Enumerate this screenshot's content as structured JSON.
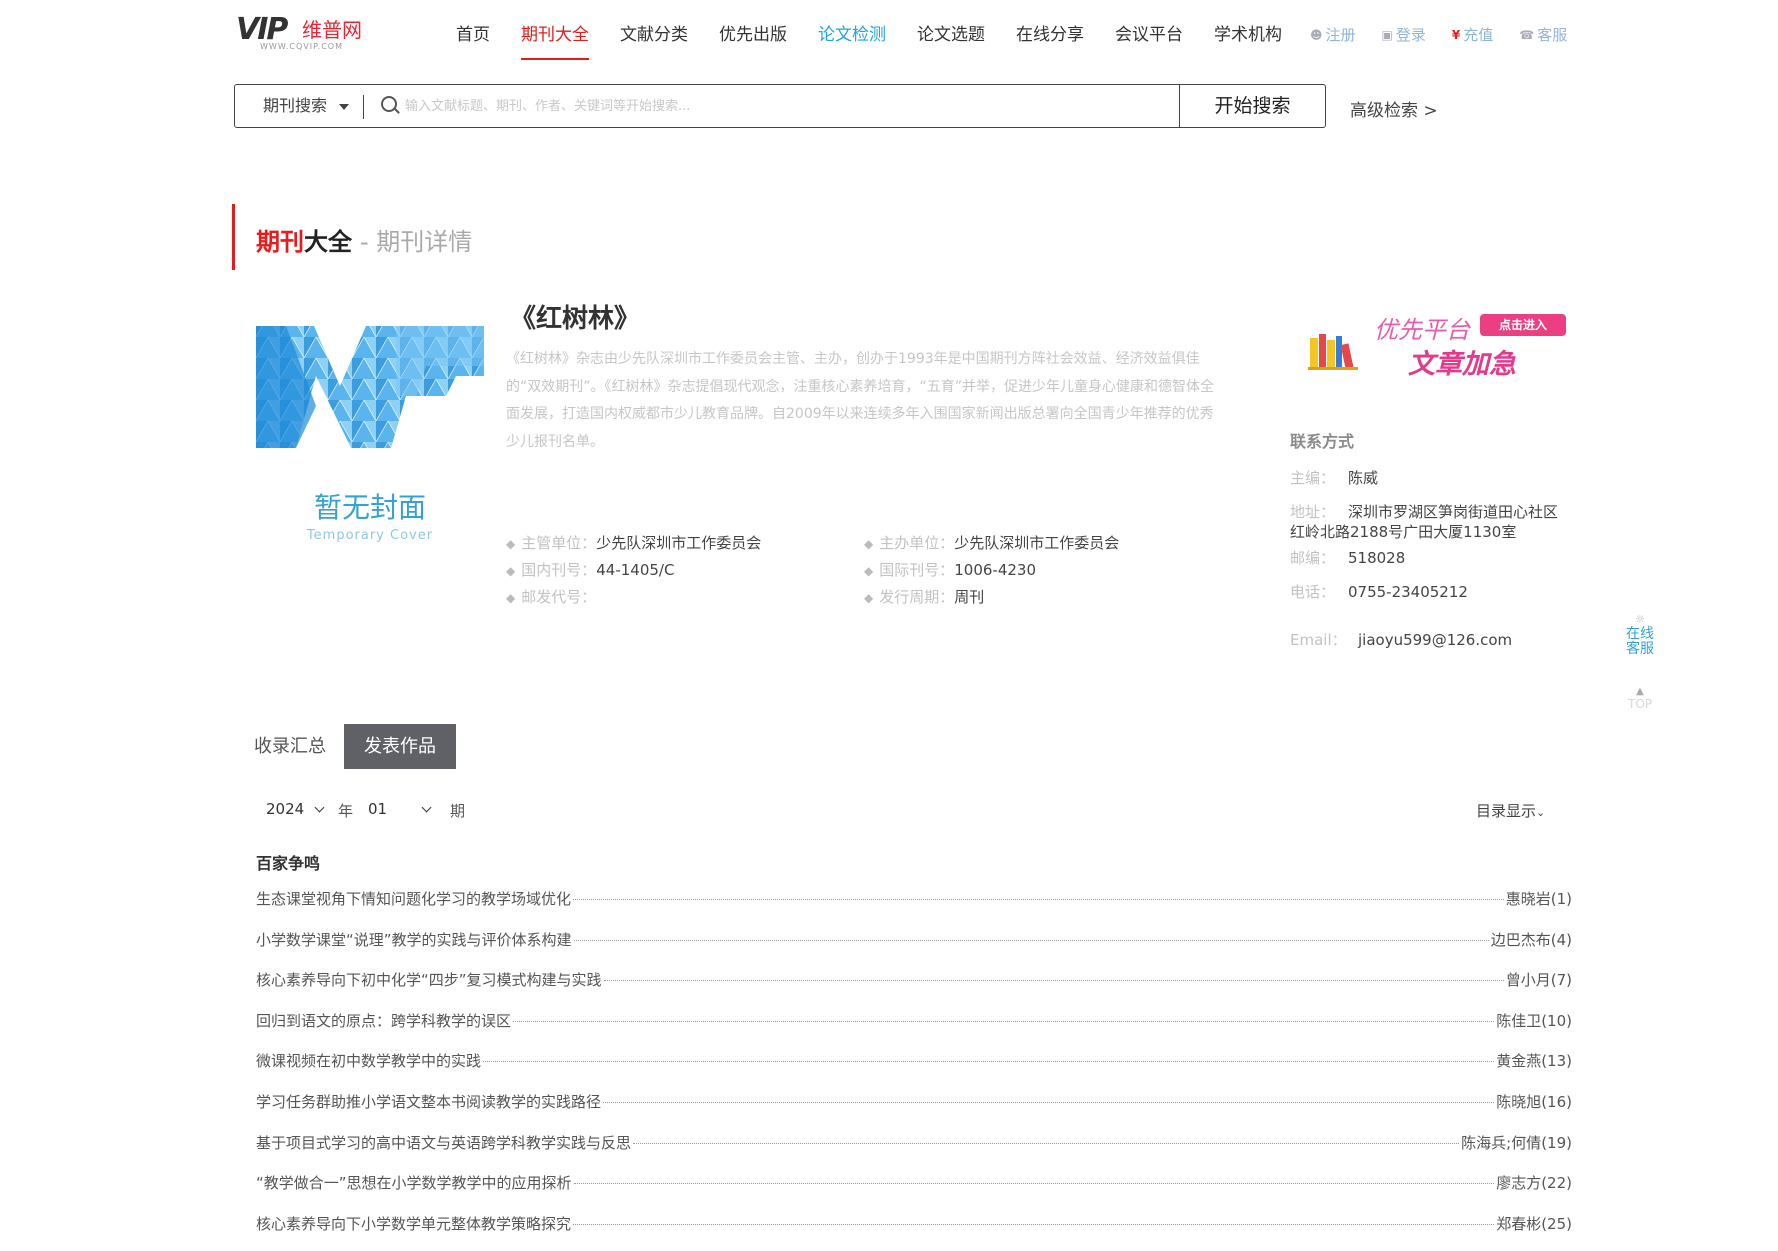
{
  "logo": {
    "vip": "VIP",
    "cn": "维普网",
    "sub": "WWW.CQVIP.COM"
  },
  "nav": [
    {
      "label": "首页",
      "state": ""
    },
    {
      "label": "期刊大全",
      "state": "active"
    },
    {
      "label": "文献分类",
      "state": ""
    },
    {
      "label": "优先出版",
      "state": ""
    },
    {
      "label": "论文检测",
      "state": "hl"
    },
    {
      "label": "论文选题",
      "state": ""
    },
    {
      "label": "在线分享",
      "state": ""
    },
    {
      "label": "会议平台",
      "state": ""
    },
    {
      "label": "学术机构",
      "state": ""
    }
  ],
  "user_links": {
    "register": "注册",
    "login": "登录",
    "recharge": "充值",
    "service": "客服"
  },
  "search": {
    "type": "期刊搜索",
    "placeholder": "输入文献标题、期刊、作者、关键词等开始搜索...",
    "button": "开始搜索",
    "advanced": "高级检索 >"
  },
  "section": {
    "title_red": "期刊",
    "title_black": "大全",
    "subtitle": "- 期刊详情"
  },
  "cover": {
    "text": "暂无封面",
    "sub": "Temporary Cover"
  },
  "journal": {
    "title": "《红树林》",
    "description": "《红树林》杂志由少先队深圳市工作委员会主管、主办，创办于1993年是中国期刊方阵社会效益、经济效益俱佳的“双效期刊”。《红树林》杂志提倡现代观念，注重核心素养培育，“五育”并举，促进少年儿童身心健康和德智体全面发展，打造国内权威都市少儿教育品牌。自2009年以来连续多年入围国家新闻出版总署向全国青少年推荐的优秀少儿报刊名单。",
    "meta": {
      "supervisor_label": "主管单位：",
      "supervisor": "少先队深圳市工作委员会",
      "sponsor_label": "主办单位：",
      "sponsor": "少先队深圳市工作委员会",
      "cn_label": "国内刊号：",
      "cn": "44-1405/C",
      "issn_label": "国际刊号：",
      "issn": "1006-4230",
      "postal_label": "邮发代号：",
      "postal": "",
      "period_label": "发行周期：",
      "period": "周刊"
    }
  },
  "promo": {
    "line1": "优先平台",
    "badge": "点击进入",
    "line2": "文章加急"
  },
  "contact": {
    "title": "联系方式",
    "editor_label": "主编：",
    "editor": "陈威",
    "address_label": "地址：",
    "address1": "深圳市罗湖区笋岗街道田心社区",
    "address2": "红岭北路2188号广田大厦1130室",
    "zip_label": "邮编：",
    "zip": "518028",
    "phone_label": "电话：",
    "phone": "0755-23405212",
    "email_label": "Email：",
    "email": "jiaoyu599@126.com"
  },
  "float": {
    "service": "在线客服",
    "service_1": "在线",
    "service_2": "客服",
    "top": "TOP"
  },
  "tabs": {
    "summary": "收录汇总",
    "published": "发表作品"
  },
  "filters": {
    "year": "2024",
    "year_unit": "年",
    "issue": "01",
    "issue_unit": "期",
    "toc_toggle": "目录显示"
  },
  "category": "百家争鸣",
  "toc": [
    {
      "title": "生态课堂视角下情知问题化学习的教学场域优化",
      "author": "惠晓岩(1)"
    },
    {
      "title": "小学数学课堂“说理”教学的实践与评价体系构建",
      "author": "边巴杰布(4)"
    },
    {
      "title": "核心素养导向下初中化学“四步”复习模式构建与实践",
      "author": "曾小月(7)"
    },
    {
      "title": "回归到语文的原点：跨学科教学的误区",
      "author": "陈佳卫(10)"
    },
    {
      "title": "微课视频在初中数学教学中的实践",
      "author": "黄金燕(13)"
    },
    {
      "title": "学习任务群助推小学语文整本书阅读教学的实践路径",
      "author": "陈晓旭(16)"
    },
    {
      "title": "基于项目式学习的高中语文与英语跨学科教学实践与反思",
      "author": "陈海兵;何倩(19)"
    },
    {
      "title": "“教学做合一”思想在小学数学教学中的应用探析",
      "author": "廖志方(22)"
    },
    {
      "title": "核心素养导向下小学数学单元整体教学策略探究",
      "author": "郑春彬(25)"
    }
  ]
}
